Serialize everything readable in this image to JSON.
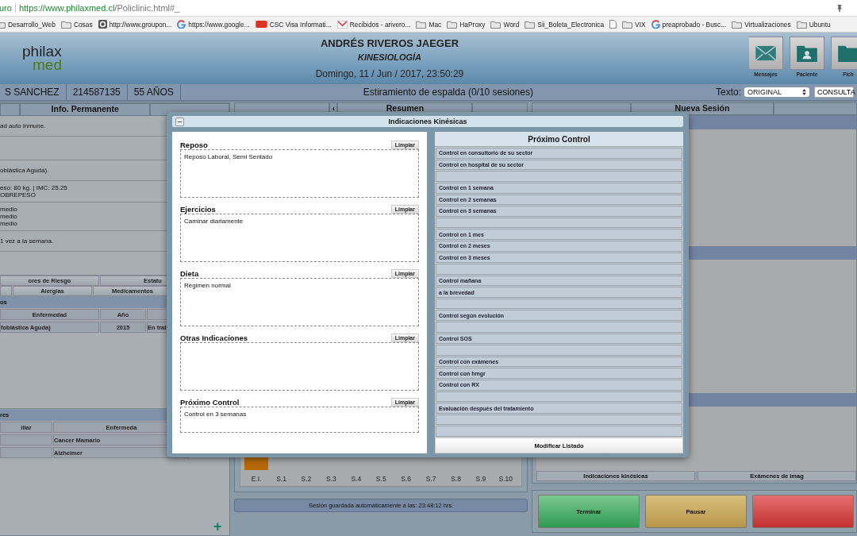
{
  "browser": {
    "security": "uro",
    "url_host": "https://www.philaxmed.cl",
    "url_path": "/Policlinic.html#_",
    "bookmarks": [
      {
        "kind": "folder",
        "label": "Desarrollo_Web"
      },
      {
        "kind": "folder",
        "label": "Cosas"
      },
      {
        "kind": "site",
        "label": "http://www.groupon..."
      },
      {
        "kind": "google",
        "label": "https://www.google..."
      },
      {
        "kind": "csc",
        "label": "CSC Visa Informati..."
      },
      {
        "kind": "mail",
        "label": "Recibidos - arivero..."
      },
      {
        "kind": "folder",
        "label": "Mac"
      },
      {
        "kind": "folder",
        "label": "HaProxy"
      },
      {
        "kind": "folder",
        "label": "Word"
      },
      {
        "kind": "folder",
        "label": "Sii_Boleta_Electronica"
      },
      {
        "kind": "page"
      },
      {
        "kind": "folder",
        "label": "VIX"
      },
      {
        "kind": "google",
        "label": "preaprobado - Busc..."
      },
      {
        "kind": "folder",
        "label": "Virtualizaciones"
      },
      {
        "kind": "folder",
        "label": "Ubuntu"
      }
    ]
  },
  "header": {
    "logo_top": "philax",
    "logo_bottom": "med",
    "doctor": "ANDRÉS RIVEROS JAEGER",
    "specialty": "KINESIOLOGÍA",
    "datetime": "Domingo, 11 / Jun / 2017, 23:50:29",
    "actions": [
      {
        "kind": "mail",
        "label": "Mensajes"
      },
      {
        "kind": "patient",
        "label": "Paciente"
      },
      {
        "kind": "file",
        "label": "Fich"
      }
    ]
  },
  "patient_bar": {
    "name": "S SANCHEZ",
    "id": "214587135",
    "age": "55 AÑOS",
    "treatment": "Estiramiento de espalda (0/10 sesiones)",
    "text_label": "Texto:",
    "text_select": "ORIGINAL",
    "consult_button": "CONSULTA"
  },
  "left_panel": {
    "tab": "Info. Permanente",
    "rows": [
      [
        "ad auto inmune."
      ],
      [],
      [
        "oblástica Aguda)."
      ],
      [
        "eso: 80 kg. | IMC: 25.25",
        "OBREPESO"
      ],
      [
        "medio",
        "medio",
        "medio"
      ],
      [
        "1 vez a la semana."
      ],
      []
    ],
    "buttons_row1": [
      "ores de Riesgo",
      "Estatu"
    ],
    "buttons_row2": [
      "Alergias",
      "Medicamentos"
    ],
    "diseases": {
      "title": "os",
      "columns": [
        "Enfermedad",
        "Año",
        ""
      ],
      "rows": [
        [
          "foblástica Aguda)",
          "2015",
          "En trat"
        ]
      ]
    },
    "family": {
      "title": "res",
      "columns": [
        "iliar",
        "Enfermeda"
      ],
      "rows": [
        [
          "",
          "Cancer Mamario"
        ],
        [
          "",
          "Alzheimer"
        ]
      ]
    },
    "add_button": "+"
  },
  "middle_panel": {
    "tabs": [
      "‹",
      "Resumen"
    ],
    "sessions": [
      {
        "label": "E.I.",
        "filled": true
      },
      {
        "label": "S.1",
        "filled": false
      },
      {
        "label": "S.2",
        "filled": false
      },
      {
        "label": "S.3",
        "filled": false
      },
      {
        "label": "S.4",
        "filled": false
      },
      {
        "label": "S.5",
        "filled": false
      },
      {
        "label": "S.6",
        "filled": false
      },
      {
        "label": "S.7",
        "filled": false
      },
      {
        "label": "S.8",
        "filled": false
      },
      {
        "label": "S.9",
        "filled": false
      },
      {
        "label": "S.10",
        "filled": false
      }
    ],
    "autosave": "Sesión guardada automáticamente a las: 23:48:12 hrs."
  },
  "right_panel": {
    "tab": "Nueva Sesión",
    "tabs_bottom": [
      "Indicaciones kinésicas",
      "Exámenes de imag"
    ],
    "actions": [
      {
        "kind": "finish",
        "label": "Terminar"
      },
      {
        "kind": "pause",
        "label": "Pausar"
      },
      {
        "kind": "cancel"
      }
    ]
  },
  "modal": {
    "title": "Indicaciones Kinésicas",
    "sections": [
      {
        "title": "Reposo",
        "clear_label": "Limpiar",
        "value": "Reposo Laboral, Semi Sentado"
      },
      {
        "title": "Ejercicios",
        "clear_label": "Limpiar",
        "value": "Caminar diariamente"
      },
      {
        "title": "Dieta",
        "clear_label": "Limpiar",
        "value": "Régimen normal"
      },
      {
        "title": "Otras Indicaciones",
        "clear_label": "Limpiar"
      },
      {
        "title": "Próximo Control",
        "clear_label": "Limpiar",
        "value": "Control en 3 semanas"
      }
    ],
    "list_title": "Próximo Control",
    "options": [
      {
        "kind": "option",
        "label": "Control en consultorio de su sector"
      },
      {
        "kind": "option",
        "label": "Control en hospital de su sector"
      },
      {
        "kind": "blank"
      },
      {
        "kind": "option",
        "label": "Control en 1 semana"
      },
      {
        "kind": "option",
        "label": "Control en 2 semanas"
      },
      {
        "kind": "option",
        "label": "Control en 3 semanas"
      },
      {
        "kind": "blank"
      },
      {
        "kind": "option",
        "label": "Control en 1 mes"
      },
      {
        "kind": "option",
        "label": "Control en 2 meses"
      },
      {
        "kind": "option",
        "label": "Control en 3 meses"
      },
      {
        "kind": "blank"
      },
      {
        "kind": "option",
        "label": "Control mañana"
      },
      {
        "kind": "option",
        "label": "a la brevedad"
      },
      {
        "kind": "blank"
      },
      {
        "kind": "option",
        "label": "Control según evolución"
      },
      {
        "kind": "blank"
      },
      {
        "kind": "option",
        "label": "Control SOS"
      },
      {
        "kind": "blank"
      },
      {
        "kind": "option",
        "label": "Control con exámenes"
      },
      {
        "kind": "option",
        "label": "Control con hmgr"
      },
      {
        "kind": "option",
        "label": "Control con RX"
      },
      {
        "kind": "blank"
      },
      {
        "kind": "option",
        "label": "Evaluación después del tratamiento"
      },
      {
        "kind": "blank"
      },
      {
        "kind": "blank"
      }
    ],
    "modify_button": "Modificar Listado"
  }
}
